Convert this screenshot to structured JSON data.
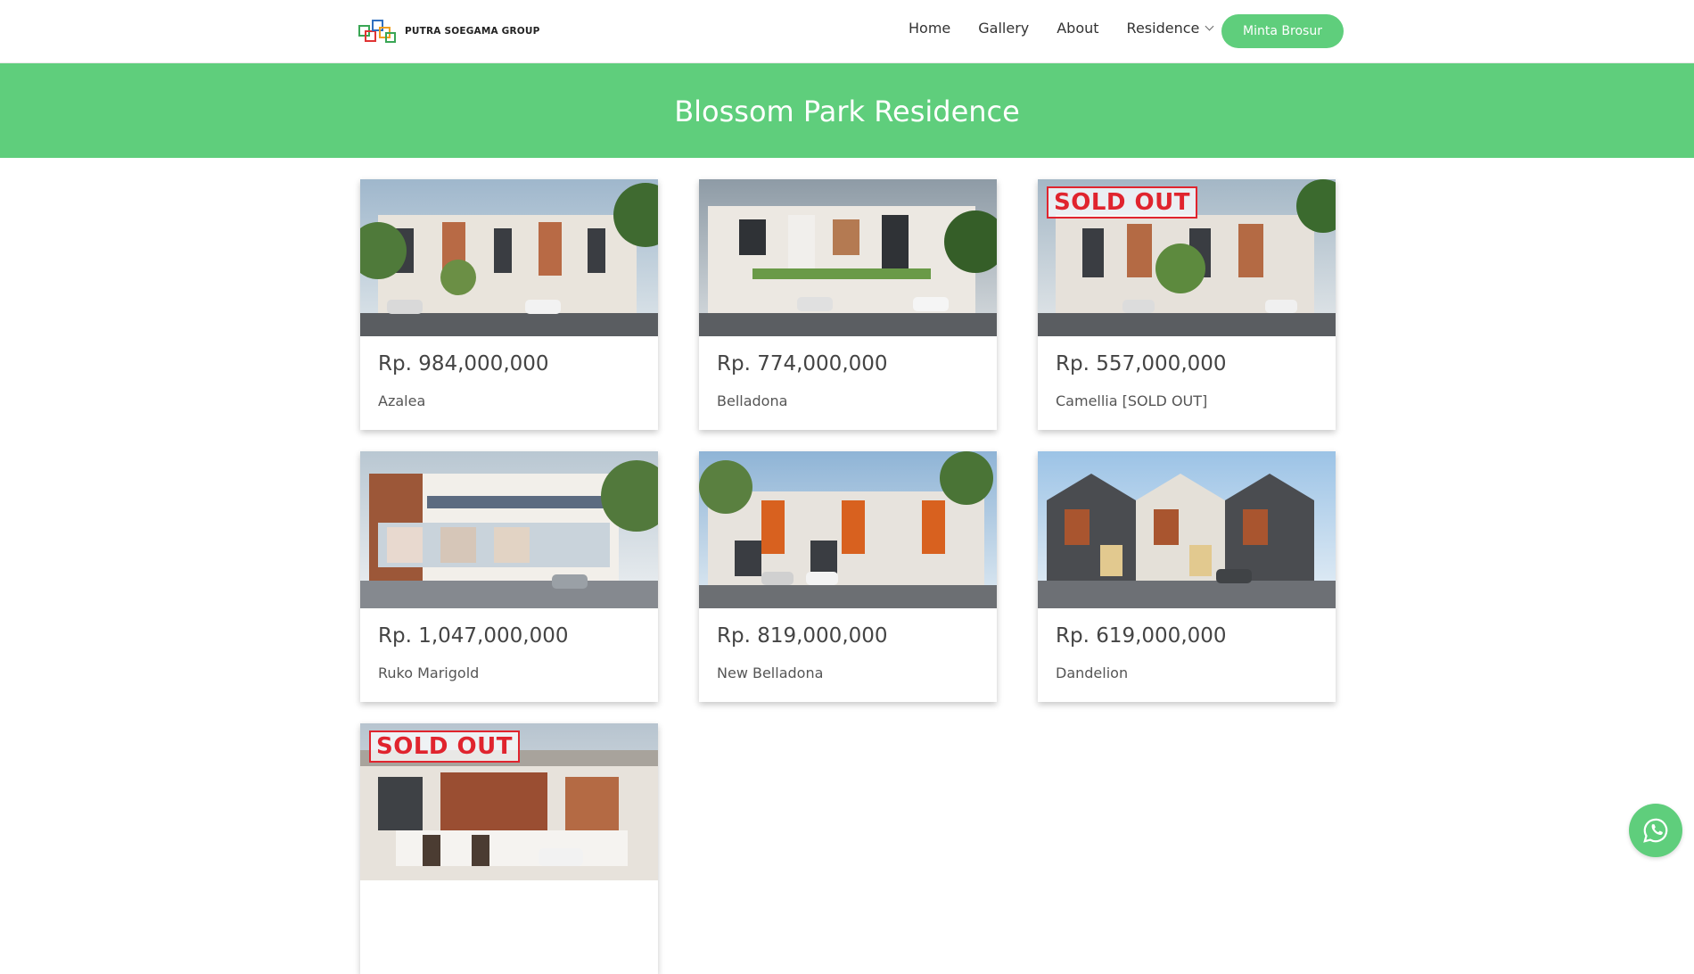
{
  "brand": {
    "name": "PUTRA SOEGAMA GROUP",
    "logo_icon": "squares-logo-icon"
  },
  "nav": {
    "items": [
      "Home",
      "Gallery",
      "About",
      "Residence"
    ],
    "cta": "Minta Brosur"
  },
  "page": {
    "title": "Blossom Park Residence"
  },
  "colors": {
    "accent": "#5fce7c",
    "sold_out": "#e0242e"
  },
  "listings": [
    {
      "price": "Rp. 984,000,000",
      "name": "Azalea",
      "sold_out_badge": ""
    },
    {
      "price": "Rp. 774,000,000",
      "name": "Belladona",
      "sold_out_badge": ""
    },
    {
      "price": "Rp. 557,000,000",
      "name": "Camellia [SOLD OUT]",
      "sold_out_badge": "SOLD OUT"
    },
    {
      "price": "Rp. 1,047,000,000",
      "name": "Ruko Marigold",
      "sold_out_badge": ""
    },
    {
      "price": "Rp. 819,000,000",
      "name": "New Belladona",
      "sold_out_badge": ""
    },
    {
      "price": "Rp. 619,000,000",
      "name": "Dandelion",
      "sold_out_badge": ""
    },
    {
      "price": "",
      "name": "",
      "sold_out_badge": "SOLD OUT"
    }
  ],
  "floating": {
    "icon": "whatsapp-icon"
  }
}
